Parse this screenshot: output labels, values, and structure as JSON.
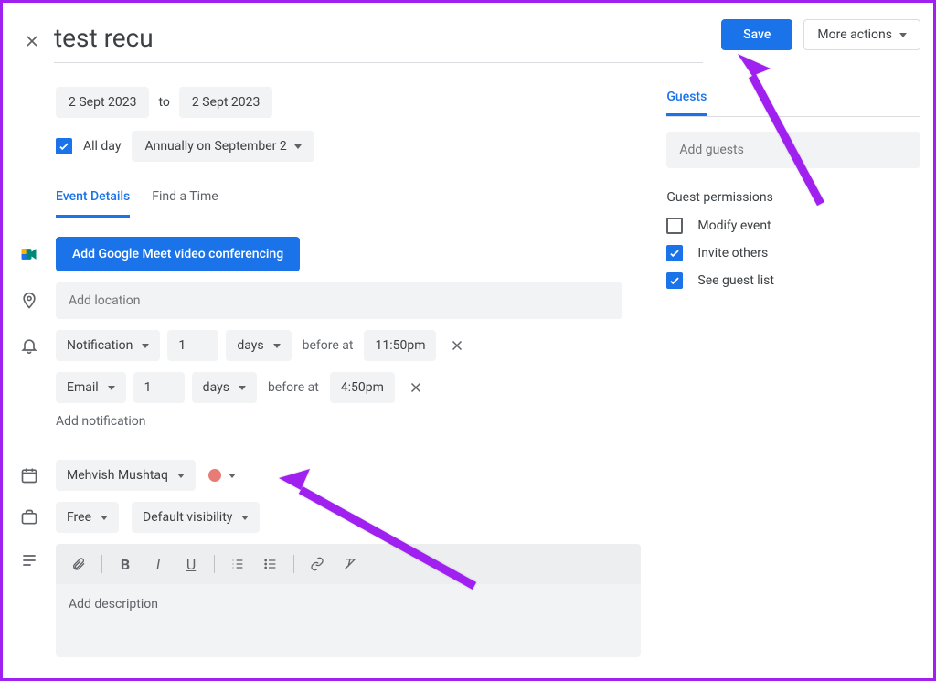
{
  "header": {
    "title": "test recu",
    "save": "Save",
    "more": "More actions"
  },
  "dates": {
    "start": "2 Sept 2023",
    "to": "to",
    "end": "2 Sept 2023"
  },
  "allday": {
    "label": "All day",
    "checked": true,
    "recurrence": "Annually on September 2"
  },
  "tabs": {
    "details": "Event Details",
    "findtime": "Find a Time"
  },
  "meet": {
    "label": "Add Google Meet video conferencing"
  },
  "location": {
    "placeholder": "Add location"
  },
  "notifications": [
    {
      "type": "Notification",
      "count": "1",
      "unit": "days",
      "before": "before at",
      "time": "11:50pm"
    },
    {
      "type": "Email",
      "count": "1",
      "unit": "days",
      "before": "before at",
      "time": "4:50pm"
    }
  ],
  "addNotification": "Add notification",
  "calendar": {
    "name": "Mehvish Mushtaq"
  },
  "availability": {
    "status": "Free",
    "visibility": "Default visibility"
  },
  "description": {
    "placeholder": "Add description"
  },
  "guests": {
    "tab": "Guests",
    "placeholder": "Add guests",
    "permissionsTitle": "Guest permissions",
    "modify": "Modify event",
    "invite": "Invite others",
    "seeList": "See guest list"
  }
}
